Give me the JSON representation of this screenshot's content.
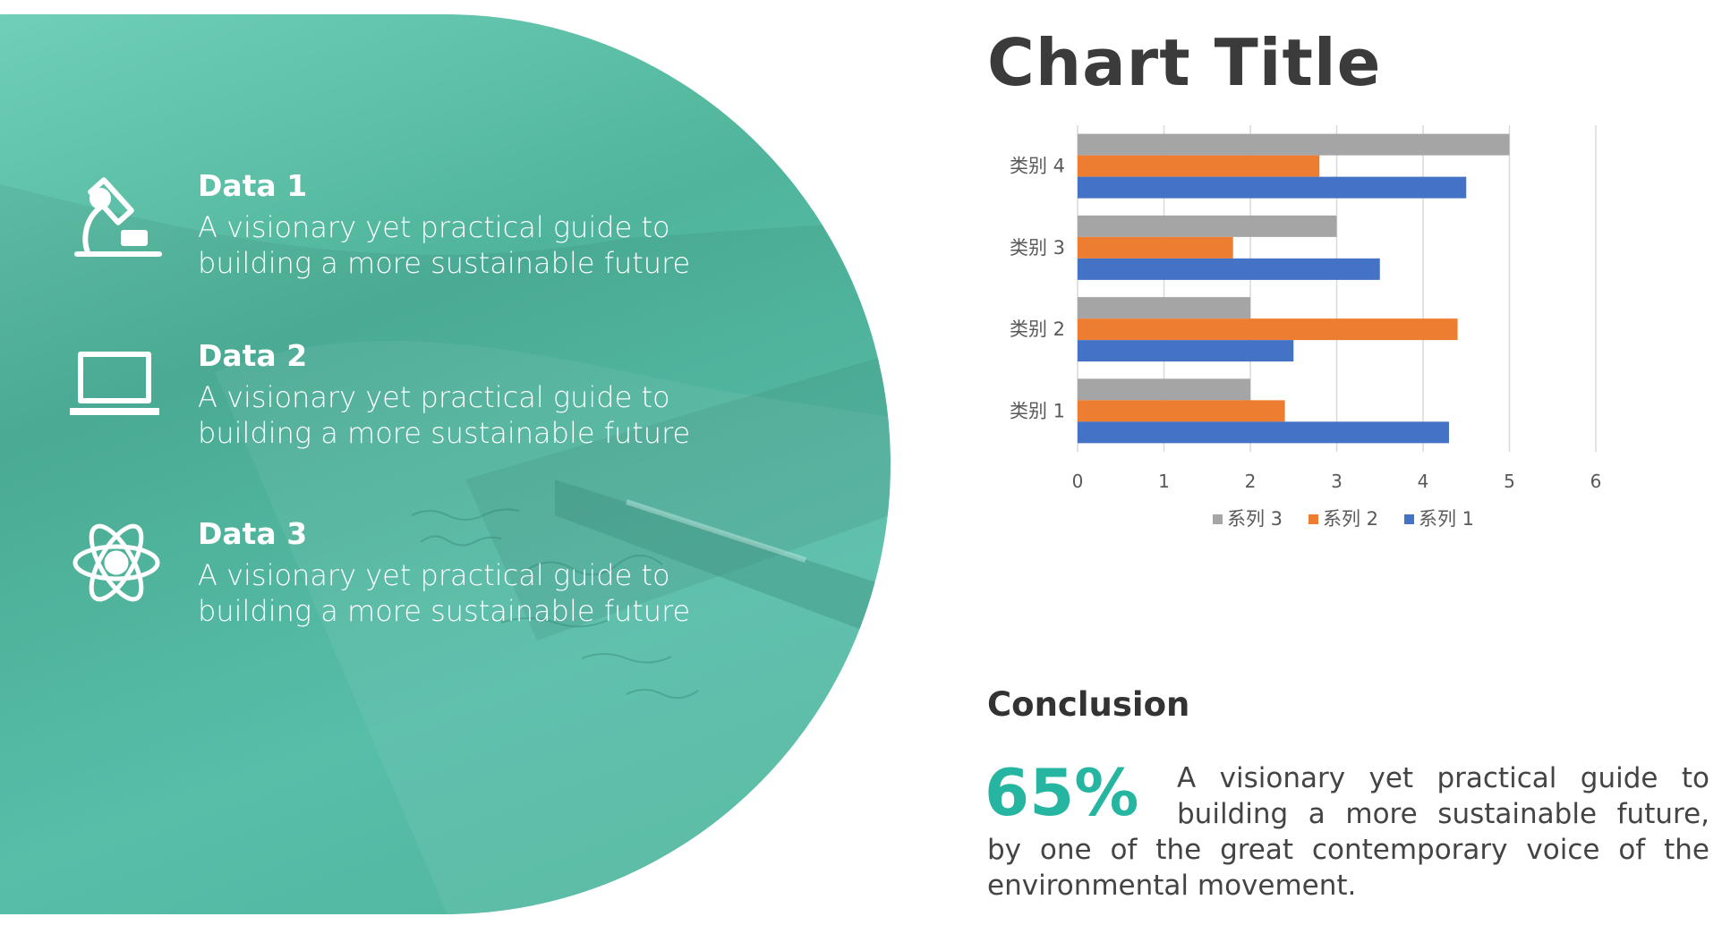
{
  "items": [
    {
      "title": "Data 1",
      "desc": "A visionary yet practical guide to building a more sustainable future",
      "icon": "microscope-icon"
    },
    {
      "title": "Data 2",
      "desc": "A visionary yet practical guide to building a more sustainable future",
      "icon": "laptop-icon"
    },
    {
      "title": "Data 3",
      "desc": "A visionary yet practical guide to building a more sustainable future",
      "icon": "atom-icon"
    }
  ],
  "chart_title": "Chart Title",
  "chart_data": {
    "type": "bar",
    "orientation": "horizontal",
    "categories": [
      "类别 1",
      "类别 2",
      "类别 3",
      "类别 4"
    ],
    "series": [
      {
        "name": "系列 1",
        "values": [
          4.3,
          2.5,
          3.5,
          4.5
        ],
        "color": "#4472c4"
      },
      {
        "name": "系列 2",
        "values": [
          2.4,
          4.4,
          1.8,
          2.8
        ],
        "color": "#ed7d31"
      },
      {
        "name": "系列 3",
        "values": [
          2,
          2,
          3,
          5
        ],
        "color": "#a5a5a5"
      }
    ],
    "xlim": [
      0,
      6
    ],
    "ticks": [
      "0",
      "1",
      "2",
      "3",
      "4",
      "5",
      "6"
    ],
    "legend": [
      "系列 3",
      "系列 2",
      "系列 1"
    ],
    "legend_position": "bottom",
    "grid": true
  },
  "conclusion": {
    "heading": "Conclusion",
    "percent": "65%",
    "text_line1": "A visionary yet practical guide to",
    "text_line2": "building a more sustainable future,",
    "text_line3": "by one of the great contemporary voice of the",
    "text_line4": "environmental movement."
  },
  "colors": {
    "accent": "#26b5a0",
    "hero": "#5cc9b2"
  }
}
